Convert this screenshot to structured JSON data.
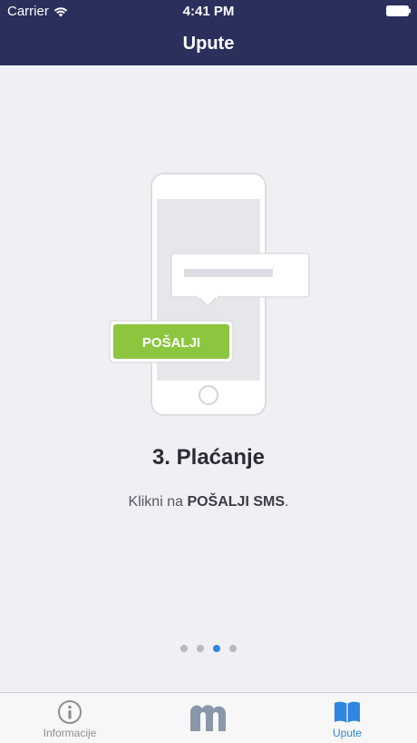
{
  "status": {
    "carrier": "Carrier",
    "time": "4:41 PM"
  },
  "nav": {
    "title": "Upute"
  },
  "slide": {
    "button_label": "POŠALJI",
    "title": "3. Plaćanje",
    "desc_prefix": "Klikni na ",
    "desc_bold": "POŠALJI SMS",
    "desc_suffix": ".",
    "page_count": 4,
    "active_page": 3
  },
  "tabs": [
    {
      "label": "Informacije",
      "icon": "info-icon",
      "selected": false
    },
    {
      "label": "",
      "icon": "m-logo-icon",
      "selected": false
    },
    {
      "label": "Upute",
      "icon": "book-icon",
      "selected": true
    }
  ],
  "colors": {
    "nav_bg": "#2b2f5c",
    "accent": "#2e86de",
    "button_green": "#8cc63f",
    "background": "#efeff4"
  }
}
